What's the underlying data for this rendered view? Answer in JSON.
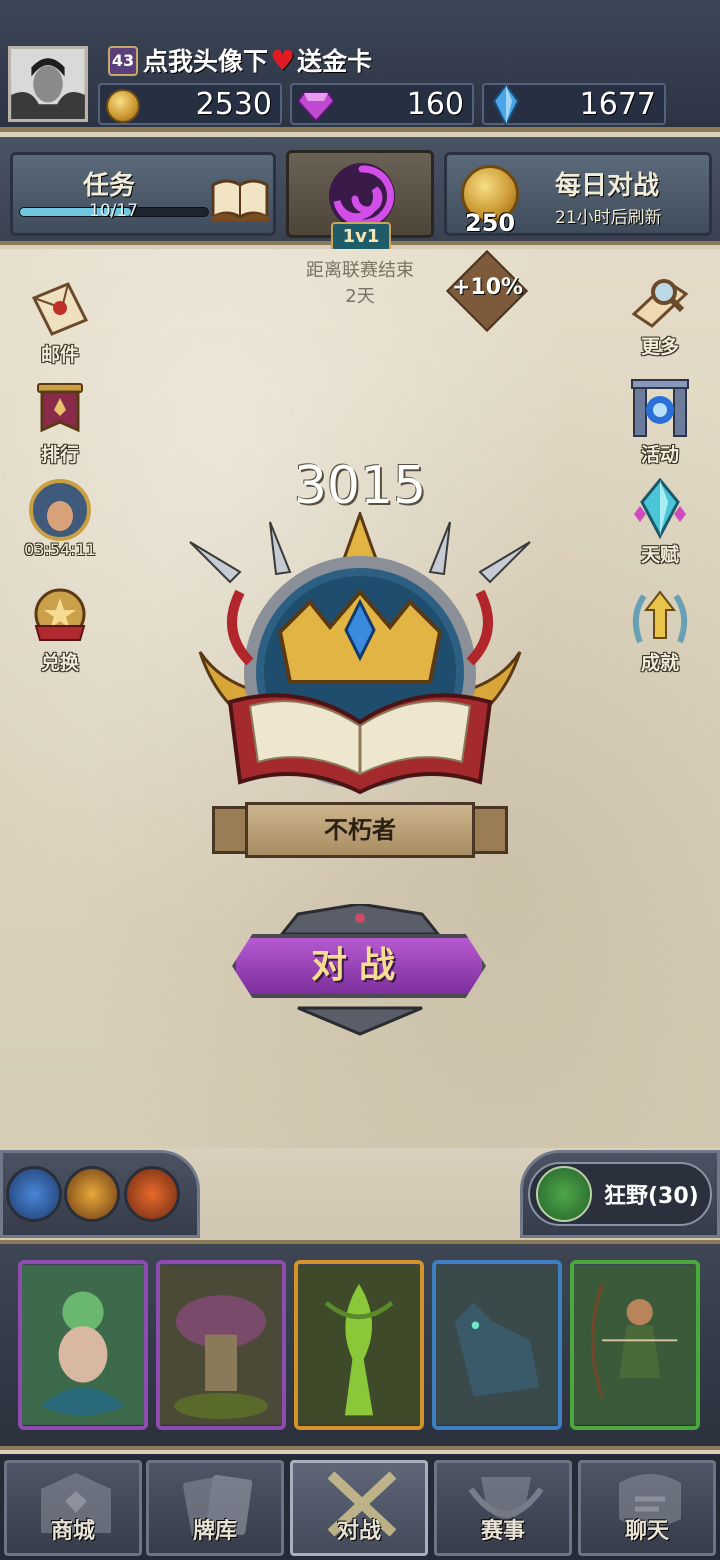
{
  "player": {
    "level": "43",
    "promo_text": "点我头像下",
    "promo_text2": "送金卡"
  },
  "currencies": {
    "gold": "2530",
    "gems": "160",
    "crystals": "1677"
  },
  "tasks": {
    "title": "任务",
    "progress_text": "10/17",
    "progress_fraction": 0.588
  },
  "mode": {
    "badge": "1v1",
    "league_end_label": "距离联赛结束",
    "league_end_value": "2天",
    "bonus": "+10%"
  },
  "daily_battle": {
    "title": "每日对战",
    "reward": "250",
    "refresh_text": "21小时后刷新"
  },
  "left_menu": [
    {
      "label": "邮件",
      "icon": "mail-icon"
    },
    {
      "label": "排行",
      "icon": "ranking-banner-icon"
    },
    {
      "label": "03:54:11",
      "icon": "hero-portrait-icon"
    },
    {
      "label": "兑换",
      "icon": "exchange-medal-icon"
    }
  ],
  "right_menu": [
    {
      "label": "更多",
      "icon": "magnifier-scroll-icon"
    },
    {
      "label": "活动",
      "icon": "portal-icon"
    },
    {
      "label": "天赋",
      "icon": "crystal-icon"
    },
    {
      "label": "成就",
      "icon": "laurel-arrow-icon"
    }
  ],
  "rank": {
    "score": "3015",
    "title": "不朽者"
  },
  "battle_button": "对战",
  "faction_filter": {
    "label": "狂野(30)"
  },
  "cards": [
    {
      "name": "naga-card",
      "frame": "#8e4bb0"
    },
    {
      "name": "mushroom-card",
      "frame": "#8e4bb0"
    },
    {
      "name": "dryad-card",
      "frame": "#d8922a"
    },
    {
      "name": "wolf-card",
      "frame": "#3d7fc0"
    },
    {
      "name": "archer-card",
      "frame": "#4aa83c"
    }
  ],
  "bottom_nav": [
    {
      "label": "商城",
      "icon": "shop-icon"
    },
    {
      "label": "牌库",
      "icon": "deck-icon"
    },
    {
      "label": "对战",
      "icon": "crossed-swords-icon",
      "active": true
    },
    {
      "label": "赛事",
      "icon": "tournament-icon"
    },
    {
      "label": "聊天",
      "icon": "chat-icon"
    }
  ],
  "colors": {
    "accent_purple": "#9a44bd",
    "gold": "#d9a73a",
    "panel": "#3f4c5c"
  }
}
